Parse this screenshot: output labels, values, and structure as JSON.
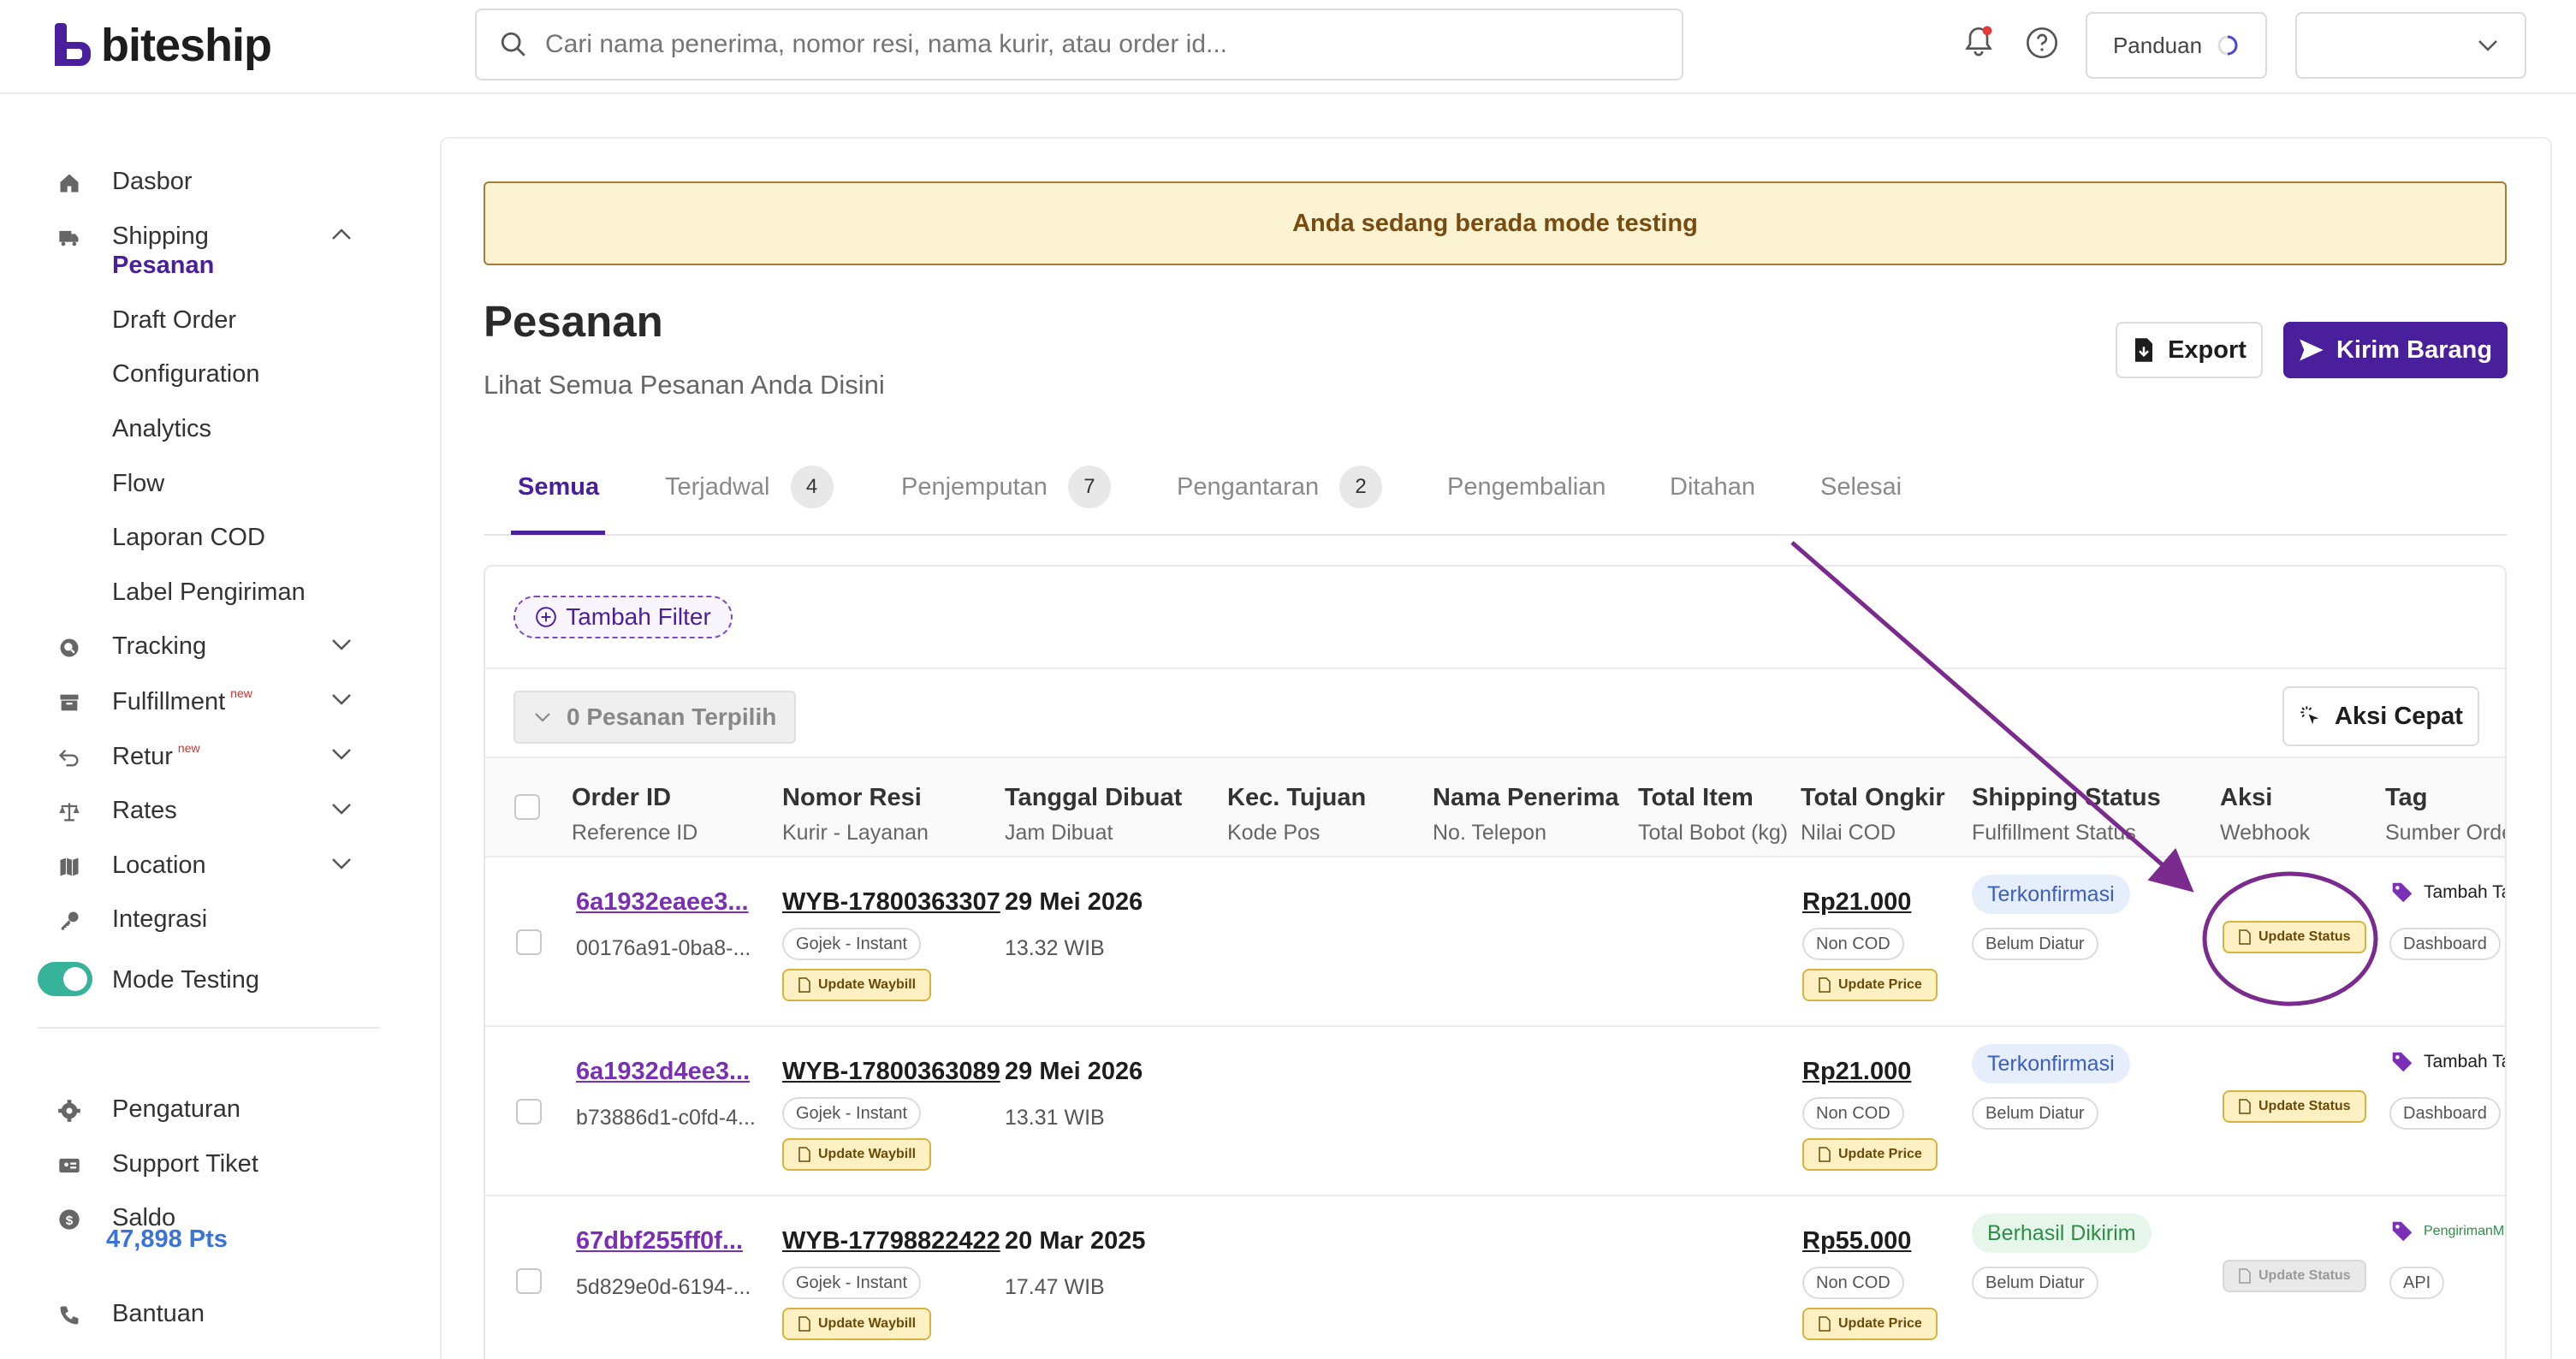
{
  "brand": {
    "name": "biteship",
    "accent": "#4a1f9c"
  },
  "topbar": {
    "search_placeholder": "Cari nama penerima, nomor resi, nama kurir, atau order id...",
    "panduan_label": "Panduan",
    "account_label": ""
  },
  "sidebar": {
    "items": [
      {
        "label": "Dasbor",
        "icon": "home-icon"
      },
      {
        "label": "Shipping",
        "icon": "truck-icon"
      },
      {
        "label": "Tracking",
        "icon": "tracking-icon"
      },
      {
        "label": "Fulfillment",
        "icon": "box-icon",
        "badge": "new"
      },
      {
        "label": "Retur",
        "icon": "return-icon",
        "badge": "new"
      },
      {
        "label": "Rates",
        "icon": "scale-icon"
      },
      {
        "label": "Location",
        "icon": "map-icon"
      },
      {
        "label": "Integrasi",
        "icon": "key-icon"
      },
      {
        "label": "Mode Testing",
        "icon": "toggle-icon"
      },
      {
        "label": "Pengaturan",
        "icon": "gear-icon"
      },
      {
        "label": "Support Tiket",
        "icon": "ticket-icon"
      },
      {
        "label": "Saldo",
        "icon": "coin-icon"
      },
      {
        "label": "Bantuan",
        "icon": "phone-icon"
      }
    ],
    "shipping_sub": [
      "Pesanan",
      "Draft Order",
      "Configuration",
      "Analytics",
      "Flow",
      "Laporan COD",
      "Label Pengiriman"
    ],
    "saldo_points": "47,898 Pts"
  },
  "banner": "Anda sedang berada mode testing",
  "page": {
    "title": "Pesanan",
    "subtitle": "Lihat Semua Pesanan Anda Disini",
    "export_label": "Export",
    "kirim_label": "Kirim Barang"
  },
  "tabs": [
    {
      "label": "Semua",
      "count": ""
    },
    {
      "label": "Terjadwal",
      "count": "4"
    },
    {
      "label": "Penjemputan",
      "count": "7"
    },
    {
      "label": "Pengantaran",
      "count": "2"
    },
    {
      "label": "Pengembalian",
      "count": ""
    },
    {
      "label": "Ditahan",
      "count": ""
    },
    {
      "label": "Selesai",
      "count": ""
    }
  ],
  "toolbar": {
    "filter_label": "Tambah Filter",
    "selected_label": "0 Pesanan Terpilih",
    "aksi_label": "Aksi Cepat"
  },
  "table": {
    "headers": [
      {
        "h1": "Order ID",
        "h2": "Reference ID"
      },
      {
        "h1": "Nomor Resi",
        "h2": "Kurir - Layanan"
      },
      {
        "h1": "Tanggal Dibuat",
        "h2": "Jam Dibuat"
      },
      {
        "h1": "Kec. Tujuan",
        "h2": "Kode Pos"
      },
      {
        "h1": "Nama Penerima",
        "h2": "No. Telepon"
      },
      {
        "h1": "Total Item",
        "h2": "Total Bobot (kg)"
      },
      {
        "h1": "Total Ongkir",
        "h2": "Nilai COD"
      },
      {
        "h1": "Shipping Status",
        "h2": "Fulfillment Status"
      },
      {
        "h1": "Aksi",
        "h2": "Webhook"
      },
      {
        "h1": "Tag",
        "h2": "Sumber Orde"
      }
    ],
    "rows": [
      {
        "order_id": "6a1932eaee3...",
        "ref_id": "00176a91-0ba8-...",
        "resi": "WYB-17800363307",
        "courier": "Gojek - Instant",
        "waybill_btn": "Update Waybill",
        "date": "29 Mei 2026",
        "time": "13.32 WIB",
        "ongkir": "Rp21.000",
        "cod": "Non COD",
        "price_btn": "Update Price",
        "status": "Terkonfirmasi",
        "status_color": "blue",
        "fulfill": "Belum Diatur",
        "aksi_btn": "Update Status",
        "aksi_disabled": false,
        "tag": "Tambah Ta",
        "source": "Dashboard"
      },
      {
        "order_id": "6a1932d4ee3...",
        "ref_id": "b73886d1-c0fd-4...",
        "resi": "WYB-17800363089",
        "courier": "Gojek - Instant",
        "waybill_btn": "Update Waybill",
        "date": "29 Mei 2026",
        "time": "13.31 WIB",
        "ongkir": "Rp21.000",
        "cod": "Non COD",
        "price_btn": "Update Price",
        "status": "Terkonfirmasi",
        "status_color": "blue",
        "fulfill": "Belum Diatur",
        "aksi_btn": "Update Status",
        "aksi_disabled": false,
        "tag": "Tambah Ta",
        "source": "Dashboard"
      },
      {
        "order_id": "67dbf255ff0f...",
        "ref_id": "5d829e0d-6194-...",
        "resi": "WYB-17798822422",
        "courier": "Gojek - Instant",
        "waybill_btn": "Update Waybill",
        "date": "20 Mar 2025",
        "time": "17.47 WIB",
        "ongkir": "Rp55.000",
        "cod": "Non COD",
        "price_btn": "Update Price",
        "status": "Berhasil Dikirim",
        "status_color": "green",
        "fulfill": "Belum Diatur",
        "aksi_btn": "Update Status",
        "aksi_disabled": true,
        "tag": "PengirimanM",
        "source": "API"
      }
    ]
  },
  "annotation_color": "#7b2a8e"
}
